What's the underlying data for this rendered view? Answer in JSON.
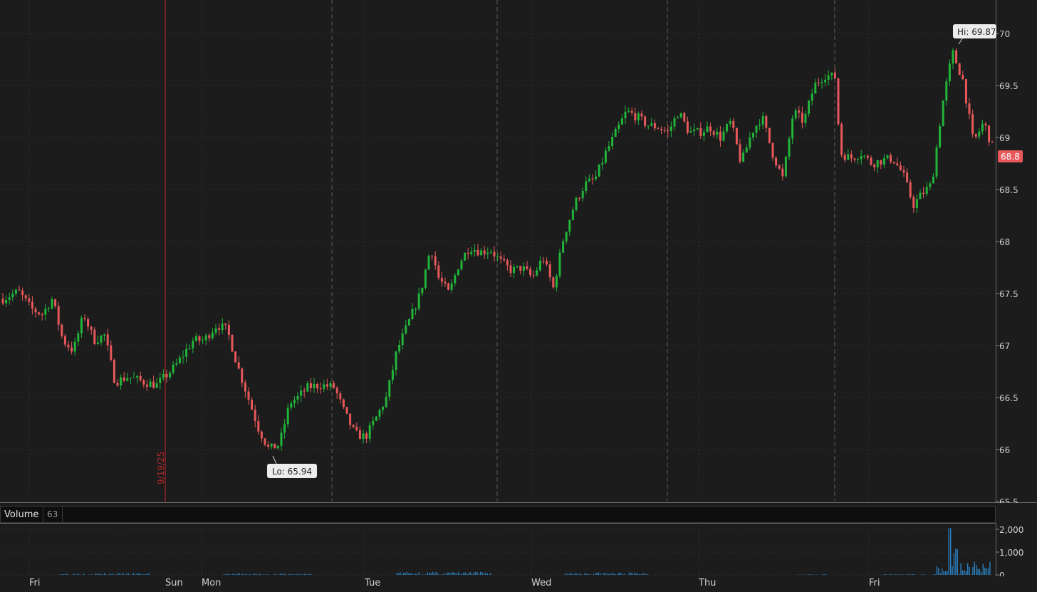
{
  "chart_data": {
    "type": "candlestick",
    "ylim": [
      65.5,
      70
    ],
    "y_ticks": [
      "70",
      "69.5",
      "69",
      "68.5",
      "68",
      "67.5",
      "67",
      "66.5",
      "66",
      "65.5"
    ],
    "x_tick_labels": [
      "Fri",
      "Sun",
      "Mon",
      "Tue",
      "Wed",
      "Thu",
      "Fri"
    ],
    "date_marker": "9/19/25",
    "high_label": "Hi: 69.87",
    "low_label": "Lo: 65.94",
    "last_price": "68.8",
    "price_path": [
      [
        0,
        67.45
      ],
      [
        0.3,
        67.52
      ],
      [
        0.55,
        67.35
      ],
      [
        0.75,
        67.3
      ],
      [
        0.95,
        67.45
      ],
      [
        1.15,
        67.05
      ],
      [
        1.35,
        66.95
      ],
      [
        1.55,
        67.3
      ],
      [
        1.75,
        67.05
      ],
      [
        1.95,
        67.1
      ],
      [
        2.15,
        66.65
      ],
      [
        2.4,
        66.7
      ],
      [
        2.7,
        66.65
      ],
      [
        2.95,
        66.62
      ],
      [
        3.3,
        66.8
      ],
      [
        3.65,
        67.05
      ],
      [
        3.85,
        67.05
      ],
      [
        4.1,
        67.2
      ],
      [
        4.3,
        67.15
      ],
      [
        4.5,
        66.8
      ],
      [
        4.7,
        66.5
      ],
      [
        4.9,
        66.2
      ],
      [
        5.1,
        66.0
      ],
      [
        5.3,
        66.05
      ],
      [
        5.5,
        66.45
      ],
      [
        5.65,
        66.5
      ],
      [
        5.85,
        66.6
      ],
      [
        6.1,
        66.62
      ],
      [
        6.35,
        66.6
      ],
      [
        6.55,
        66.35
      ],
      [
        6.75,
        66.15
      ],
      [
        6.95,
        66.12
      ],
      [
        7.15,
        66.3
      ],
      [
        7.35,
        66.5
      ],
      [
        7.55,
        66.95
      ],
      [
        7.8,
        67.25
      ],
      [
        8.0,
        67.5
      ],
      [
        8.2,
        67.95
      ],
      [
        8.35,
        67.65
      ],
      [
        8.55,
        67.5
      ],
      [
        8.75,
        67.8
      ],
      [
        8.95,
        67.95
      ],
      [
        9.15,
        67.9
      ],
      [
        9.35,
        67.92
      ],
      [
        9.55,
        67.8
      ],
      [
        9.75,
        67.72
      ],
      [
        9.95,
        67.75
      ],
      [
        10.15,
        67.65
      ],
      [
        10.35,
        67.85
      ],
      [
        10.55,
        67.55
      ],
      [
        10.75,
        68.05
      ],
      [
        10.95,
        68.35
      ],
      [
        11.15,
        68.55
      ],
      [
        11.35,
        68.6
      ],
      [
        11.55,
        68.85
      ],
      [
        11.75,
        69.05
      ],
      [
        11.95,
        69.25
      ],
      [
        12.15,
        69.2
      ],
      [
        12.35,
        69.12
      ],
      [
        12.55,
        69.1
      ],
      [
        12.75,
        69.05
      ],
      [
        12.95,
        69.25
      ],
      [
        13.15,
        69.05
      ],
      [
        13.35,
        69.05
      ],
      [
        13.55,
        69.1
      ],
      [
        13.75,
        69.0
      ],
      [
        13.95,
        69.15
      ],
      [
        14.15,
        68.75
      ],
      [
        14.35,
        69.05
      ],
      [
        14.55,
        69.2
      ],
      [
        14.75,
        68.85
      ],
      [
        14.95,
        68.6
      ],
      [
        15.15,
        69.25
      ],
      [
        15.35,
        69.15
      ],
      [
        15.55,
        69.5
      ],
      [
        15.75,
        69.6
      ],
      [
        15.95,
        69.58
      ],
      [
        16.05,
        68.85
      ],
      [
        16.25,
        68.8
      ],
      [
        16.45,
        68.85
      ],
      [
        16.65,
        68.75
      ],
      [
        16.85,
        68.78
      ],
      [
        17.05,
        68.8
      ],
      [
        17.25,
        68.65
      ],
      [
        17.45,
        68.35
      ],
      [
        17.6,
        68.45
      ],
      [
        17.8,
        68.55
      ],
      [
        18.0,
        69.3
      ],
      [
        18.2,
        69.82
      ],
      [
        18.4,
        69.55
      ],
      [
        18.6,
        68.95
      ],
      [
        18.8,
        69.15
      ],
      [
        19.0,
        68.85
      ]
    ],
    "volume": {
      "y_ticks": [
        "2,000",
        "1,000",
        "0"
      ],
      "ylim": [
        0,
        2000
      ],
      "header_label": "Volume",
      "header_value": "63"
    }
  }
}
